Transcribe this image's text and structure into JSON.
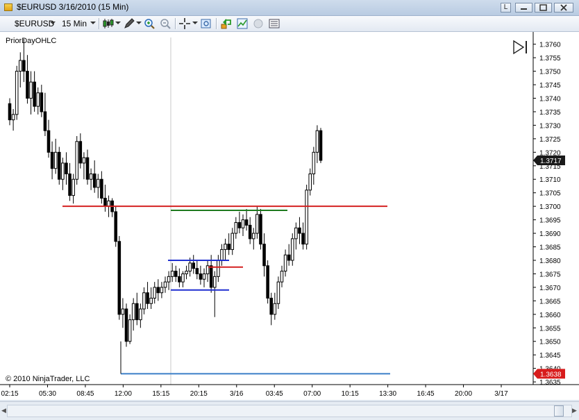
{
  "window": {
    "title": "$EURUSD  3/16/2010 (15 Min)",
    "btn_l": "L"
  },
  "toolbar": {
    "instrument": "$EURUSD",
    "interval": "15 Min"
  },
  "chart": {
    "indicator_label": "PriorDayOHLC",
    "copyright": "© 2010 NinjaTrader, LLC",
    "current_price_label": "1.3717",
    "low_price_label": "1.3638",
    "colors": {
      "prior_high": "#d42020",
      "prior_low": "#3a7fc8",
      "green_level": "#1e7a1e",
      "blue_level": "#1f2fd0",
      "red_level": "#d42020",
      "price_badge": "#1a1a1a",
      "low_badge": "#d81c1c"
    }
  },
  "chart_data": {
    "type": "candlestick",
    "instrument": "$EURUSD",
    "interval": "15 Min",
    "y_ticks": [
      "1.3760",
      "1.3755",
      "1.3750",
      "1.3745",
      "1.3740",
      "1.3735",
      "1.3730",
      "1.3725",
      "1.3720",
      "1.3715",
      "1.3710",
      "1.3705",
      "1.3700",
      "1.3695",
      "1.3690",
      "1.3685",
      "1.3680",
      "1.3675",
      "1.3670",
      "1.3665",
      "1.3660",
      "1.3655",
      "1.3650",
      "1.3645",
      "1.3640",
      "1.3635"
    ],
    "ylim": [
      1.3634,
      1.3763
    ],
    "x_ticks": [
      "02:15",
      "05:30",
      "08:45",
      "12:00",
      "15:15",
      "20:15",
      "3/16",
      "03:45",
      "07:00",
      "10:15",
      "13:30",
      "16:45",
      "20:00",
      "3/17"
    ],
    "levels": [
      {
        "price": 1.37,
        "color": "#d42020"
      },
      {
        "price": 1.36985,
        "color": "#1e7a1e"
      },
      {
        "price": 1.368,
        "color": "#1f2fd0"
      },
      {
        "price": 1.36775,
        "color": "#d42020"
      },
      {
        "price": 1.3669,
        "color": "#1f2fd0"
      },
      {
        "price": 1.3638,
        "color": "#3a7fc8"
      }
    ],
    "candles": [
      [
        1.3738,
        1.374,
        1.373,
        1.3732
      ],
      [
        1.3732,
        1.3736,
        1.3728,
        1.3734
      ],
      [
        1.3734,
        1.3752,
        1.3732,
        1.375
      ],
      [
        1.375,
        1.3757,
        1.3744,
        1.3754
      ],
      [
        1.3754,
        1.3762,
        1.3746,
        1.375
      ],
      [
        1.375,
        1.3756,
        1.3738,
        1.374
      ],
      [
        1.374,
        1.375,
        1.3734,
        1.3746
      ],
      [
        1.3746,
        1.375,
        1.3735,
        1.3737
      ],
      [
        1.3737,
        1.3744,
        1.3734,
        1.3742
      ],
      [
        1.3742,
        1.3745,
        1.3733,
        1.3735
      ],
      [
        1.3735,
        1.3742,
        1.3726,
        1.3728
      ],
      [
        1.3728,
        1.3732,
        1.3718,
        1.372
      ],
      [
        1.372,
        1.3724,
        1.371,
        1.3714
      ],
      [
        1.3714,
        1.3725,
        1.3712,
        1.372
      ],
      [
        1.372,
        1.3722,
        1.3708,
        1.371
      ],
      [
        1.371,
        1.3718,
        1.3706,
        1.3716
      ],
      [
        1.3716,
        1.372,
        1.3708,
        1.3712
      ],
      [
        1.3712,
        1.3716,
        1.3702,
        1.3704
      ],
      [
        1.3704,
        1.3712,
        1.3701,
        1.371
      ],
      [
        1.371,
        1.3726,
        1.3708,
        1.3724
      ],
      [
        1.3724,
        1.3727,
        1.3714,
        1.3716
      ],
      [
        1.3716,
        1.372,
        1.371,
        1.3718
      ],
      [
        1.3718,
        1.3721,
        1.3708,
        1.371
      ],
      [
        1.371,
        1.3714,
        1.3706,
        1.3712
      ],
      [
        1.3712,
        1.3717,
        1.3705,
        1.3707
      ],
      [
        1.3707,
        1.3712,
        1.3703,
        1.371
      ],
      [
        1.371,
        1.3713,
        1.3701,
        1.3703
      ],
      [
        1.3703,
        1.3708,
        1.3698,
        1.37
      ],
      [
        1.37,
        1.3704,
        1.3696,
        1.3702
      ],
      [
        1.3702,
        1.3703,
        1.3696,
        1.3698
      ],
      [
        1.3698,
        1.37,
        1.3685,
        1.3687
      ],
      [
        1.3687,
        1.3689,
        1.3658,
        1.366
      ],
      [
        1.366,
        1.3666,
        1.3655,
        1.3662
      ],
      [
        1.3662,
        1.3664,
        1.3648,
        1.365
      ],
      [
        1.365,
        1.366,
        1.3649,
        1.3658
      ],
      [
        1.3658,
        1.3666,
        1.3654,
        1.3664
      ],
      [
        1.3664,
        1.3668,
        1.3656,
        1.3658
      ],
      [
        1.3658,
        1.3664,
        1.3655,
        1.3662
      ],
      [
        1.3662,
        1.367,
        1.366,
        1.3668
      ],
      [
        1.3668,
        1.3672,
        1.3662,
        1.3664
      ],
      [
        1.3664,
        1.367,
        1.3662,
        1.3666
      ],
      [
        1.3666,
        1.3672,
        1.3664,
        1.367
      ],
      [
        1.367,
        1.3673,
        1.3665,
        1.3668
      ],
      [
        1.3668,
        1.3672,
        1.3666,
        1.367
      ],
      [
        1.367,
        1.3674,
        1.3668,
        1.3672
      ],
      [
        1.3672,
        1.3676,
        1.3669,
        1.3674
      ],
      [
        1.3674,
        1.3679,
        1.3672,
        1.3676
      ],
      [
        1.3676,
        1.3678,
        1.3672,
        1.3674
      ],
      [
        1.3674,
        1.3677,
        1.367,
        1.3672
      ],
      [
        1.3672,
        1.3676,
        1.367,
        1.3675
      ],
      [
        1.3675,
        1.3678,
        1.3673,
        1.3676
      ],
      [
        1.3676,
        1.3681,
        1.3674,
        1.3679
      ],
      [
        1.3679,
        1.3682,
        1.3675,
        1.3677
      ],
      [
        1.3677,
        1.368,
        1.3673,
        1.3675
      ],
      [
        1.3675,
        1.3678,
        1.3671,
        1.3673
      ],
      [
        1.3673,
        1.3677,
        1.367,
        1.3675
      ],
      [
        1.3675,
        1.368,
        1.3672,
        1.3678
      ],
      [
        1.3678,
        1.3682,
        1.3668,
        1.367
      ],
      [
        1.367,
        1.3676,
        1.3659,
        1.3674
      ],
      [
        1.3674,
        1.3682,
        1.3672,
        1.368
      ],
      [
        1.368,
        1.3686,
        1.3678,
        1.3684
      ],
      [
        1.3684,
        1.3688,
        1.368,
        1.3686
      ],
      [
        1.3686,
        1.369,
        1.3682,
        1.3684
      ],
      [
        1.3684,
        1.3692,
        1.3682,
        1.369
      ],
      [
        1.369,
        1.3696,
        1.3688,
        1.3694
      ],
      [
        1.3694,
        1.3698,
        1.369,
        1.3692
      ],
      [
        1.3692,
        1.3697,
        1.3689,
        1.3695
      ],
      [
        1.3695,
        1.3699,
        1.3691,
        1.3693
      ],
      [
        1.3693,
        1.3696,
        1.3686,
        1.3688
      ],
      [
        1.3688,
        1.3692,
        1.3684,
        1.369
      ],
      [
        1.369,
        1.37,
        1.3688,
        1.3697
      ],
      [
        1.3697,
        1.3699,
        1.3684,
        1.3686
      ],
      [
        1.3686,
        1.369,
        1.3674,
        1.3678
      ],
      [
        1.3678,
        1.368,
        1.3664,
        1.3666
      ],
      [
        1.3666,
        1.3668,
        1.3656,
        1.366
      ],
      [
        1.366,
        1.3668,
        1.3658,
        1.3664
      ],
      [
        1.3664,
        1.3674,
        1.3662,
        1.3672
      ],
      [
        1.3672,
        1.3678,
        1.367,
        1.3676
      ],
      [
        1.3676,
        1.3684,
        1.3674,
        1.3682
      ],
      [
        1.3682,
        1.3686,
        1.3678,
        1.368
      ],
      [
        1.368,
        1.369,
        1.3678,
        1.3688
      ],
      [
        1.3688,
        1.3694,
        1.3684,
        1.3692
      ],
      [
        1.3692,
        1.3696,
        1.3686,
        1.369
      ],
      [
        1.369,
        1.3694,
        1.3684,
        1.3686
      ],
      [
        1.3686,
        1.3708,
        1.3684,
        1.3706
      ],
      [
        1.3706,
        1.3714,
        1.3704,
        1.3712
      ],
      [
        1.3712,
        1.3722,
        1.3708,
        1.372
      ],
      [
        1.372,
        1.373,
        1.3716,
        1.3728
      ],
      [
        1.3728,
        1.3729,
        1.3716,
        1.3717
      ]
    ]
  }
}
